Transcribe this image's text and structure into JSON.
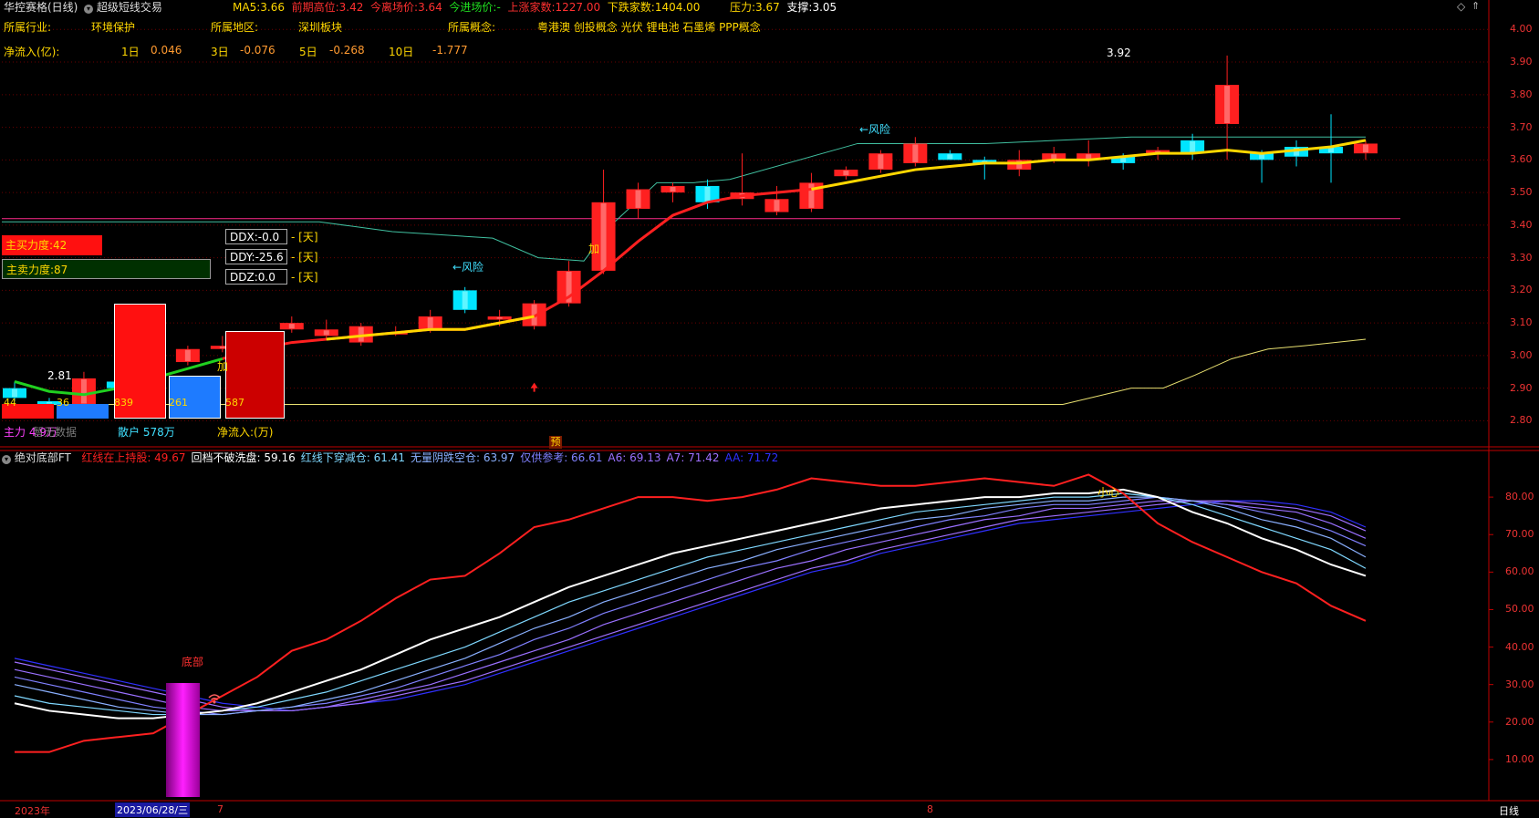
{
  "header": {
    "stock_name": "华控赛格(日线)",
    "strategy": "超级短线交易",
    "ma5_label": "MA5:",
    "ma5_value": "3.66",
    "prev_high_label": "前期高位:",
    "prev_high_value": "3.42",
    "exit_label": "今离场价:",
    "exit_value": "3.64",
    "entry_label": "今进场价:",
    "entry_value": "-",
    "up_label": "上涨家数:",
    "up_value": "1227.00",
    "down_label": "下跌家数:",
    "down_value": "1404.00",
    "press_label": "压力:",
    "press_value": "3.67",
    "support_label": "支撑:",
    "support_value": "3.05"
  },
  "info": {
    "industry_label": "所属行业:",
    "industry": "环境保护",
    "region_label": "所属地区:",
    "region": "深圳板块",
    "concept_label": "所属概念:",
    "concept": "粤港澳 创投概念 光伏 锂电池 石墨烯 PPP概念",
    "flow_label": "净流入(亿):",
    "flow": [
      {
        "period": "1日",
        "value": "0.046"
      },
      {
        "period": "3日",
        "value": "-0.076"
      },
      {
        "period": "5日",
        "value": "-0.268"
      },
      {
        "period": "10日",
        "value": "-1.777"
      }
    ]
  },
  "force": {
    "buy": "主买力度:42",
    "sell": "主卖力度:87"
  },
  "ddx": [
    {
      "label": "DDX:-0.0",
      "unit": "- [天]"
    },
    {
      "label": "DDY:-25.6",
      "unit": "- [天]"
    },
    {
      "label": "DDZ:0.0",
      "unit": "- [天]"
    }
  ],
  "money_bars": {
    "values": [
      "44",
      "36",
      "839",
      "261",
      "587"
    ],
    "labels": [
      "主力 4.9万",
      "散户 578万",
      "净流入:(万)"
    ],
    "nodata": "暂无数据"
  },
  "upper_y_axis": [
    "4.00",
    "3.90",
    "3.80",
    "3.70",
    "3.60",
    "3.50",
    "3.40",
    "3.30",
    "3.20",
    "3.10",
    "3.00",
    "2.90",
    "2.80"
  ],
  "upper_annotations": {
    "high": "3.92",
    "low": "2.81",
    "risk1": "←风险",
    "risk2": "←风险",
    "add1": "加",
    "add2": "加",
    "predict": "预"
  },
  "lower_header": {
    "name": "绝对底部FT",
    "items": [
      {
        "label": "红线在上持股:",
        "value": "49.67",
        "color": "#ff2020"
      },
      {
        "label": "回档不破洗盘:",
        "value": "59.16",
        "color": "#ffffff"
      },
      {
        "label": "红线下穿减仓:",
        "value": "61.41",
        "color": "#7fd8ff"
      },
      {
        "label": "无量阴跌空仓:",
        "value": "63.97",
        "color": "#8ab0ff"
      },
      {
        "label": "仅供参考:",
        "value": "66.61",
        "color": "#8080ff"
      },
      {
        "label": "A6:",
        "value": "69.13",
        "color": "#9a70ff"
      },
      {
        "label": "A7:",
        "value": "71.42",
        "color": "#a070ff"
      },
      {
        "label": "AA:",
        "value": "71.72",
        "color": "#3030ff"
      }
    ]
  },
  "lower_y_axis": [
    "80.00",
    "70.00",
    "60.00",
    "50.00",
    "40.00",
    "30.00",
    "20.00",
    "10.00"
  ],
  "lower_annotations": {
    "bottom": "底部",
    "small": "小心"
  },
  "date_bar": {
    "year": "2023年",
    "cursor_date": "2023/06/28/三",
    "m7": "7",
    "m8": "8",
    "period": "日线"
  },
  "colors": {
    "up": "#ff2020",
    "down": "#00e5ff",
    "axis": "#c00000",
    "ma_red": "#ff2020",
    "ma_yellow": "#ffd700"
  },
  "chart_data": [
    {
      "type": "candlestick",
      "title": "",
      "ylim": [
        2.72,
        4.04
      ],
      "x": [
        1,
        2,
        3,
        4,
        5,
        6,
        7,
        8,
        9,
        10,
        11,
        12,
        13,
        14,
        15,
        16,
        17,
        18,
        19,
        20,
        21,
        22,
        23,
        24,
        25,
        26,
        27,
        28,
        29,
        30,
        31,
        32,
        33,
        34,
        35,
        36,
        37,
        38,
        39,
        40
      ],
      "open": [
        2.9,
        2.86,
        2.85,
        2.92,
        2.92,
        2.98,
        3.02,
        3.03,
        3.08,
        3.06,
        3.04,
        3.07,
        3.08,
        3.2,
        3.11,
        3.09,
        3.16,
        3.26,
        3.45,
        3.5,
        3.52,
        3.48,
        3.44,
        3.45,
        3.55,
        3.57,
        3.59,
        3.62,
        3.6,
        3.57,
        3.6,
        3.6,
        3.61,
        3.62,
        3.66,
        3.71,
        3.62,
        3.64,
        3.64,
        3.62
      ],
      "close": [
        2.87,
        2.85,
        2.93,
        2.9,
        2.98,
        3.02,
        3.03,
        3.04,
        3.1,
        3.08,
        3.09,
        3.07,
        3.12,
        3.14,
        3.12,
        3.16,
        3.26,
        3.47,
        3.51,
        3.52,
        3.47,
        3.5,
        3.48,
        3.53,
        3.57,
        3.62,
        3.65,
        3.6,
        3.59,
        3.6,
        3.62,
        3.62,
        3.59,
        3.63,
        3.62,
        3.83,
        3.6,
        3.61,
        3.62,
        3.65
      ],
      "high": [
        2.92,
        2.87,
        2.95,
        2.94,
        3.01,
        3.03,
        3.06,
        3.05,
        3.12,
        3.11,
        3.1,
        3.09,
        3.14,
        3.21,
        3.14,
        3.17,
        3.29,
        3.57,
        3.53,
        3.53,
        3.54,
        3.62,
        3.52,
        3.56,
        3.58,
        3.63,
        3.67,
        3.63,
        3.61,
        3.63,
        3.64,
        3.66,
        3.62,
        3.64,
        3.68,
        3.92,
        3.63,
        3.66,
        3.74,
        3.66
      ],
      "low": [
        2.86,
        2.81,
        2.84,
        2.89,
        2.91,
        2.97,
        3.01,
        3.02,
        3.07,
        3.05,
        3.03,
        3.06,
        3.07,
        3.13,
        3.09,
        3.08,
        3.15,
        3.25,
        3.42,
        3.47,
        3.45,
        3.46,
        3.43,
        3.44,
        3.54,
        3.56,
        3.58,
        3.6,
        3.54,
        3.55,
        3.59,
        3.58,
        3.57,
        3.6,
        3.6,
        3.6,
        3.53,
        3.58,
        3.53,
        3.6
      ]
    },
    {
      "type": "line",
      "title": "",
      "ylim": [
        0,
        90
      ],
      "x": [
        1,
        2,
        3,
        4,
        5,
        6,
        7,
        8,
        9,
        10,
        11,
        12,
        13,
        14,
        15,
        16,
        17,
        18,
        19,
        20,
        21,
        22,
        23,
        24,
        25,
        26,
        27,
        28,
        29,
        30,
        31,
        32,
        33,
        34,
        35,
        36,
        37,
        38,
        39,
        40
      ],
      "series": [
        {
          "name": "红线在上持股",
          "color": "#ff2020",
          "values": [
            12,
            12,
            15,
            16,
            17,
            22,
            27,
            32,
            39,
            42,
            47,
            53,
            58,
            59,
            65,
            72,
            74,
            77,
            80,
            80,
            79,
            80,
            82,
            85,
            84,
            83,
            83,
            84,
            85,
            84,
            83,
            86,
            81,
            73,
            68,
            64,
            60,
            57,
            51,
            47
          ]
        },
        {
          "name": "回档不破洗盘",
          "color": "#ffffff",
          "values": [
            25,
            23,
            22,
            21,
            21,
            22,
            23,
            25,
            28,
            31,
            34,
            38,
            42,
            45,
            48,
            52,
            56,
            59,
            62,
            65,
            67,
            69,
            71,
            73,
            75,
            77,
            78,
            79,
            80,
            80,
            81,
            81,
            82,
            80,
            76,
            73,
            69,
            66,
            62,
            59
          ]
        },
        {
          "name": "红线下穿减仓",
          "color": "#7fd8ff",
          "values": [
            27,
            25,
            24,
            23,
            22,
            22,
            23,
            24,
            26,
            28,
            31,
            34,
            37,
            40,
            44,
            48,
            52,
            55,
            58,
            61,
            64,
            66,
            68,
            70,
            72,
            74,
            76,
            77,
            78,
            79,
            80,
            80,
            81,
            80,
            78,
            75,
            72,
            69,
            66,
            61
          ]
        },
        {
          "name": "无量阴跌空仓",
          "color": "#8ab0ff",
          "values": [
            30,
            28,
            26,
            24,
            23,
            22,
            22,
            23,
            24,
            26,
            28,
            31,
            34,
            37,
            41,
            45,
            48,
            52,
            55,
            58,
            61,
            63,
            66,
            68,
            70,
            72,
            74,
            75,
            77,
            78,
            79,
            79,
            80,
            80,
            79,
            77,
            74,
            72,
            69,
            64
          ]
        },
        {
          "name": "仅供参考",
          "color": "#8080ff",
          "values": [
            32,
            30,
            28,
            26,
            24,
            23,
            22,
            23,
            24,
            25,
            27,
            29,
            32,
            35,
            38,
            42,
            45,
            49,
            52,
            55,
            58,
            61,
            63,
            66,
            68,
            70,
            72,
            74,
            75,
            77,
            78,
            78,
            79,
            80,
            79,
            78,
            76,
            74,
            71,
            67
          ]
        },
        {
          "name": "A6",
          "color": "#9a70ff",
          "values": [
            34,
            32,
            30,
            28,
            26,
            24,
            23,
            23,
            23,
            24,
            26,
            28,
            30,
            33,
            36,
            39,
            42,
            46,
            49,
            52,
            55,
            58,
            61,
            63,
            66,
            68,
            70,
            72,
            74,
            75,
            77,
            77,
            78,
            79,
            79,
            78,
            77,
            76,
            73,
            69
          ]
        },
        {
          "name": "A7",
          "color": "#a070ff",
          "values": [
            36,
            34,
            32,
            30,
            28,
            26,
            24,
            23,
            23,
            24,
            25,
            27,
            29,
            31,
            34,
            37,
            40,
            43,
            46,
            49,
            52,
            55,
            58,
            61,
            63,
            66,
            68,
            70,
            72,
            74,
            75,
            76,
            77,
            78,
            79,
            79,
            78,
            77,
            75,
            71
          ]
        },
        {
          "name": "AA",
          "color": "#3030ff",
          "values": [
            37,
            35,
            33,
            31,
            29,
            27,
            25,
            24,
            23,
            24,
            25,
            26,
            28,
            30,
            33,
            36,
            39,
            42,
            45,
            48,
            51,
            54,
            57,
            60,
            62,
            65,
            67,
            69,
            71,
            73,
            74,
            75,
            76,
            77,
            78,
            79,
            79,
            78,
            76,
            72
          ]
        }
      ]
    }
  ]
}
